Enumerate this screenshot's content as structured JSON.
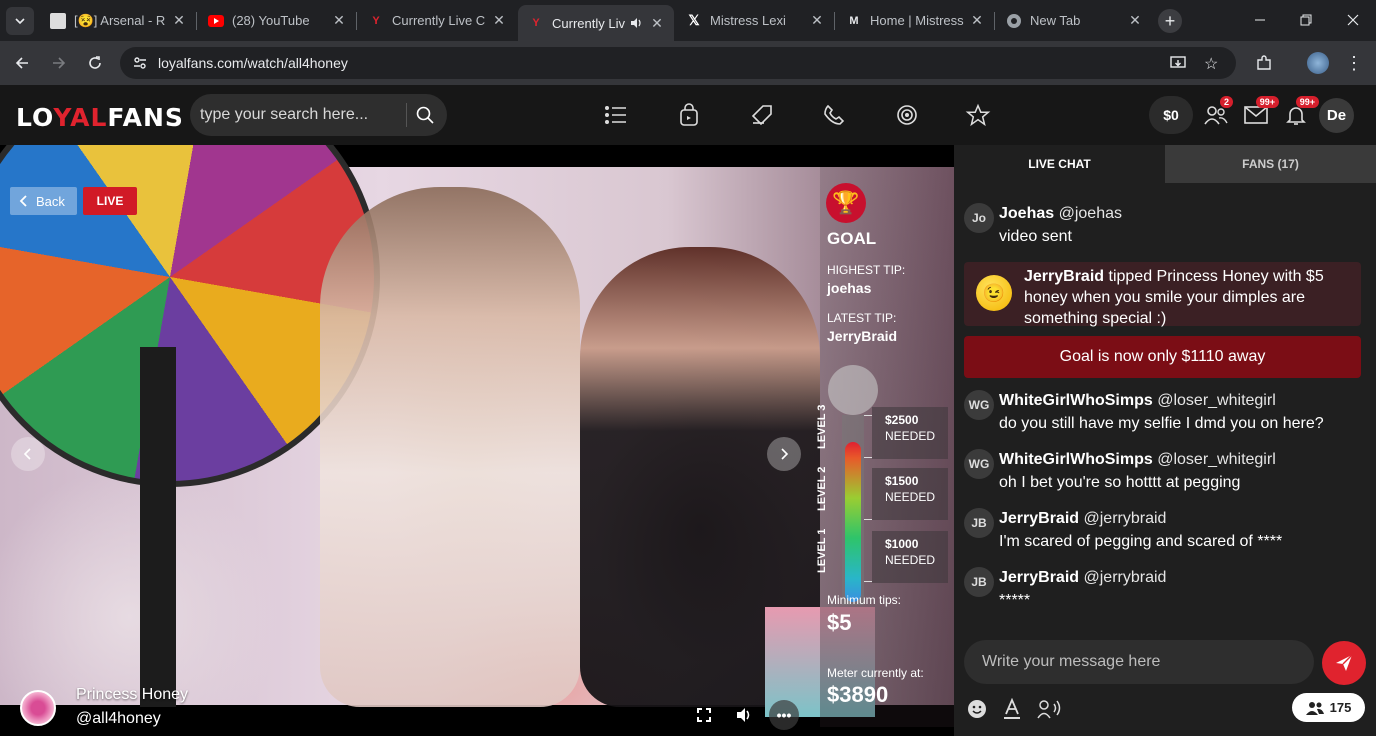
{
  "browser": {
    "tabs": [
      {
        "title": "[😵] Arsenal - R",
        "favicon": "arsenal-icon"
      },
      {
        "title": "(28) YouTube",
        "favicon": "youtube-icon"
      },
      {
        "title": "Currently Live C",
        "favicon": "loyalfans-icon"
      },
      {
        "title": "Currently Liv",
        "favicon": "loyalfans-icon",
        "active": true
      },
      {
        "title": "Mistress Lexi",
        "favicon": "x-icon"
      },
      {
        "title": "Home | Mistress",
        "favicon": "site-icon"
      },
      {
        "title": "New Tab",
        "favicon": "chrome-icon"
      }
    ],
    "url": "loyalfans.com/watch/all4honey"
  },
  "header": {
    "logo_part1": "LO",
    "logo_part2": "YAL",
    "logo_part3": "FANS",
    "search_placeholder": "type your search here...",
    "balance": "$0",
    "friends_badge": "2",
    "messages_badge": "99+",
    "notifications_badge": "99+",
    "user_initials": "De"
  },
  "video": {
    "back_label": "Back",
    "live_label": "LIVE",
    "streamer_name": "Princess Honey",
    "streamer_handle": "@all4honey"
  },
  "goal": {
    "title": "GOAL",
    "highest_tip_label": "HIGHEST TIP:",
    "highest_tip_user": "joehas",
    "latest_tip_label": "LATEST TIP:",
    "latest_tip_user": "JerryBraid",
    "levels": [
      {
        "label": "LEVEL 3",
        "amount": "$2500",
        "needed": "NEEDED"
      },
      {
        "label": "LEVEL 2",
        "amount": "$1500",
        "needed": "NEEDED"
      },
      {
        "label": "LEVEL 1",
        "amount": "$1000",
        "needed": "NEEDED"
      }
    ],
    "min_tips_label": "Minimum tips:",
    "min_tips_value": "$5",
    "meter_label": "Meter currently at:",
    "meter_value": "$3890"
  },
  "chat": {
    "tab_live": "LIVE CHAT",
    "tab_fans": "FANS (17)",
    "messages": [
      {
        "initials": "Jo",
        "user": "Joehas",
        "handle": "@joehas",
        "text": "video sent"
      },
      {
        "initials": "WG",
        "user": "WhiteGirlWhoSimps",
        "handle": "@loser_whitegirl",
        "text": "do you still have my selfie I dmd you on here?"
      },
      {
        "initials": "WG",
        "user": "WhiteGirlWhoSimps",
        "handle": "@loser_whitegirl",
        "text": "oh I bet you're so hotttt at pegging"
      },
      {
        "initials": "JB",
        "user": "JerryBraid",
        "handle": "@jerrybraid",
        "text": "I'm scared of pegging and scared of ****"
      },
      {
        "initials": "JB",
        "user": "JerryBraid",
        "handle": "@jerrybraid",
        "text": "*****"
      }
    ],
    "tip": {
      "user": "JerryBraid",
      "text": " tipped Princess Honey with $5 honey when you smile your dimples are something special :)"
    },
    "goal_banner": "Goal is now only $1110 away",
    "input_placeholder": "Write your message here",
    "viewers": "175"
  }
}
